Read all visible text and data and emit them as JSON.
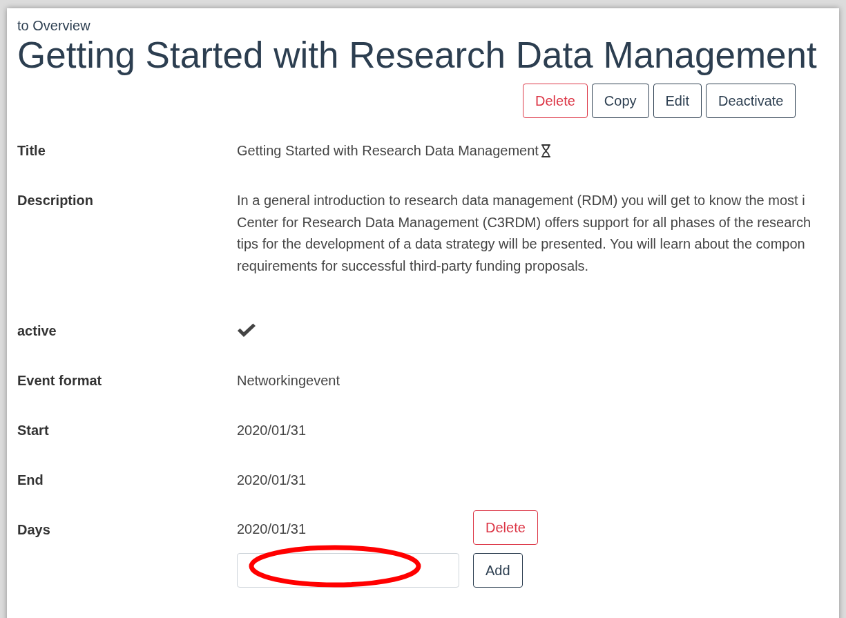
{
  "back_link": "to Overview",
  "heading": "Getting Started with Research Data Management",
  "actions": [
    {
      "label": "Delete",
      "kind": "danger"
    },
    {
      "label": "Copy",
      "kind": "default"
    },
    {
      "label": "Edit",
      "kind": "default"
    },
    {
      "label": "Deactivate",
      "kind": "default"
    }
  ],
  "fields": [
    {
      "kind": "title",
      "label": "Title",
      "value": "Getting Started with Research Data Management"
    },
    {
      "kind": "paragraph",
      "label": "Description",
      "lines": [
        "In a general introduction to research data management (RDM) you will get to know the most i",
        "Center for Research Data Management (C3RDM) offers support for all phases of the research",
        "tips for the development of a data strategy will be presented. You will learn about the compon",
        "requirements for successful third-party funding proposals."
      ]
    },
    {
      "kind": "check",
      "label": "active",
      "checked": true
    },
    {
      "kind": "text",
      "label": "Event format",
      "value": "Networkingevent"
    },
    {
      "kind": "text",
      "label": "Start",
      "value": "2020/01/31"
    },
    {
      "kind": "text",
      "label": "End",
      "value": "2020/01/31"
    },
    {
      "kind": "days",
      "label": "Days",
      "days": [
        {
          "date": "2020/01/31",
          "button": "Delete"
        }
      ],
      "add_button": "Add"
    }
  ]
}
